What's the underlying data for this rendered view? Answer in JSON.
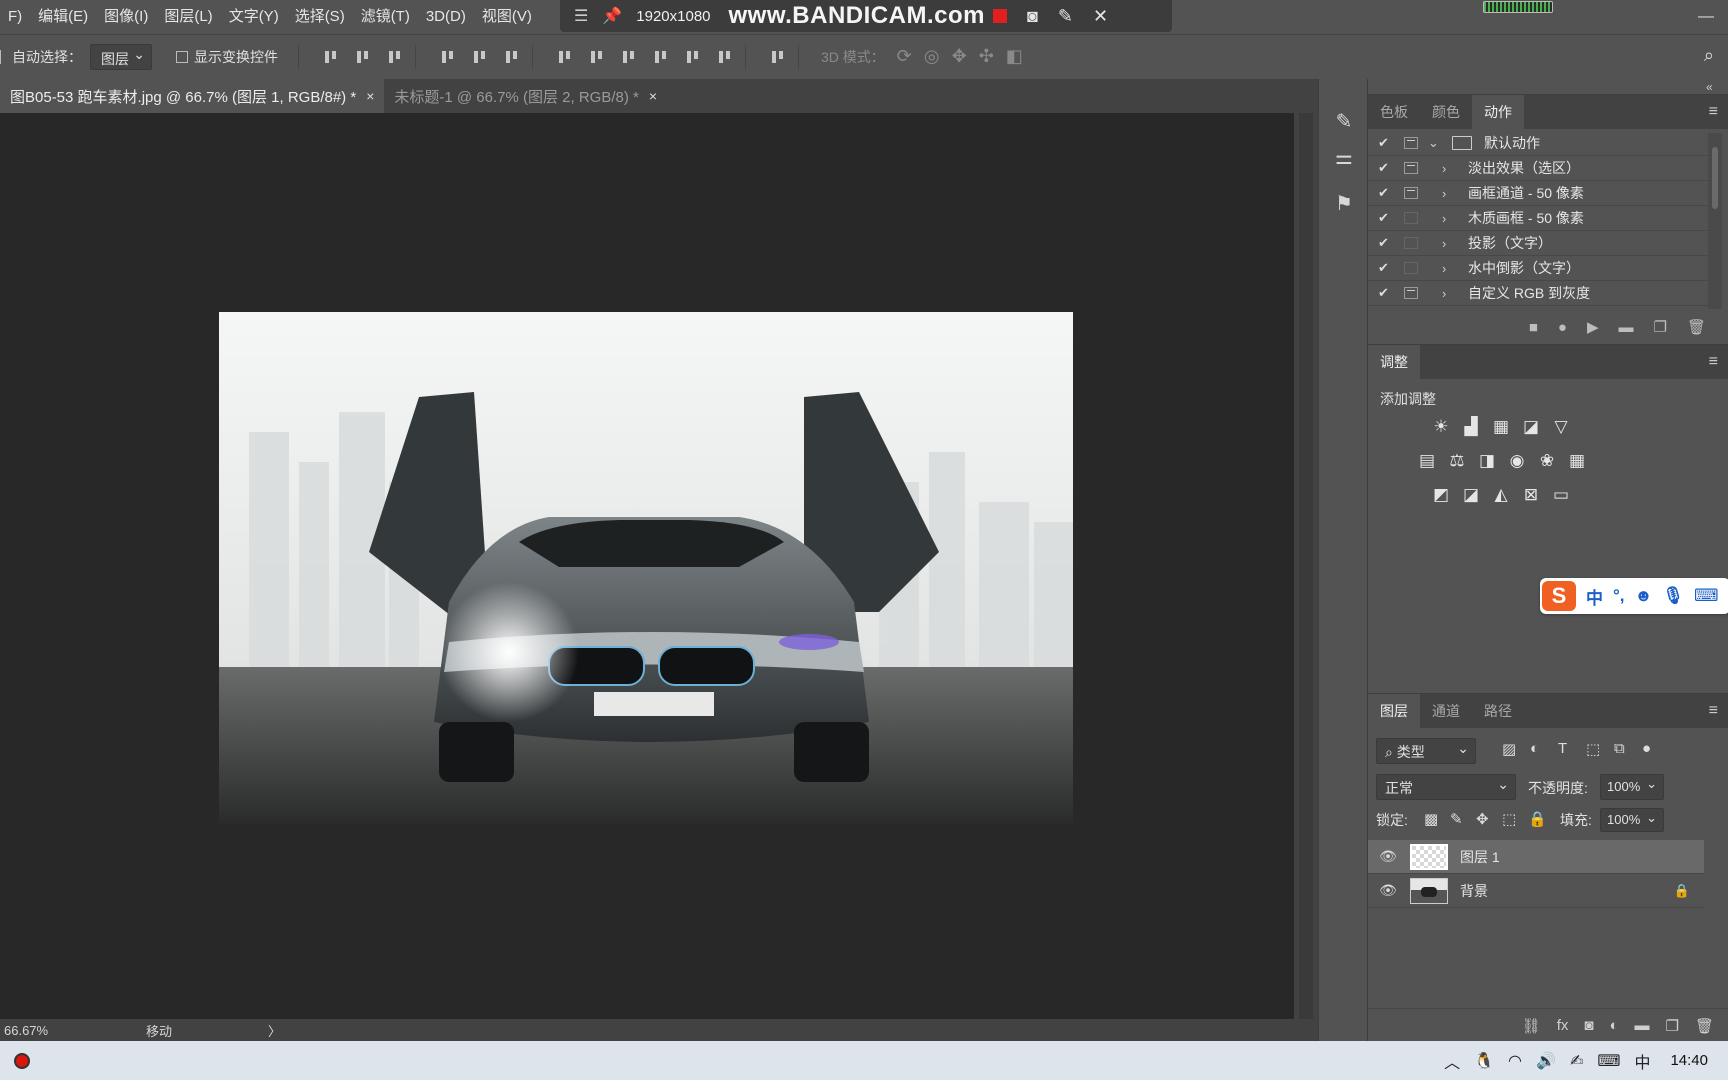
{
  "menu": {
    "items": [
      "F)",
      "编辑(E)",
      "图像(I)",
      "图层(L)",
      "文字(Y)",
      "选择(S)",
      "滤镜(T)",
      "3D(D)",
      "视图(V)"
    ]
  },
  "bandicam": {
    "resolution": "1920x1080",
    "logo": "www.BANDICAM.com"
  },
  "options_bar": {
    "auto_select_label": "自动选择：",
    "auto_select_value": "图层",
    "show_transform_label": "显示变换控件",
    "mode_3d_label": "3D 模式："
  },
  "tabs": [
    {
      "label": "图B05-53 跑车素材.jpg @ 66.7% (图层 1, RGB/8#) *",
      "close": "×"
    },
    {
      "label": "未标题-1 @ 66.7% (图层 2, RGB/8) *",
      "close": "×"
    }
  ],
  "status": {
    "zoom": "66.67%",
    "tool": "移动",
    "arrow": "〉"
  },
  "actions_panel": {
    "tabs": [
      "色板",
      "颜色",
      "动作"
    ],
    "active_tab": "动作",
    "rows": [
      {
        "label": "默认动作",
        "is_set": true,
        "box": "filled"
      },
      {
        "label": "淡出效果（选区）",
        "box": "filled"
      },
      {
        "label": "画框通道 - 50 像素",
        "box": "filled"
      },
      {
        "label": "木质画框 - 50 像素",
        "box": "empty"
      },
      {
        "label": "投影（文字）",
        "box": "empty"
      },
      {
        "label": "水中倒影（文字）",
        "box": "empty"
      },
      {
        "label": "自定义 RGB 到灰度",
        "box": "filled"
      }
    ]
  },
  "adjust_panel": {
    "title": "调整",
    "add_label": "添加调整"
  },
  "ime": {
    "mode": "中",
    "punct": "°,"
  },
  "layers_panel": {
    "tabs": [
      "图层",
      "通道",
      "路径"
    ],
    "active_tab": "图层",
    "filter_value": "类型",
    "blend_mode": "正常",
    "opacity_label": "不透明度:",
    "opacity_value": "100%",
    "lock_label": "锁定:",
    "fill_label": "填充:",
    "fill_value": "100%",
    "layers": [
      {
        "name": "图层 1",
        "selected": true
      },
      {
        "name": "背景",
        "locked": true
      }
    ]
  },
  "taskbar": {
    "time": "14:40",
    "ime_short": "中"
  }
}
